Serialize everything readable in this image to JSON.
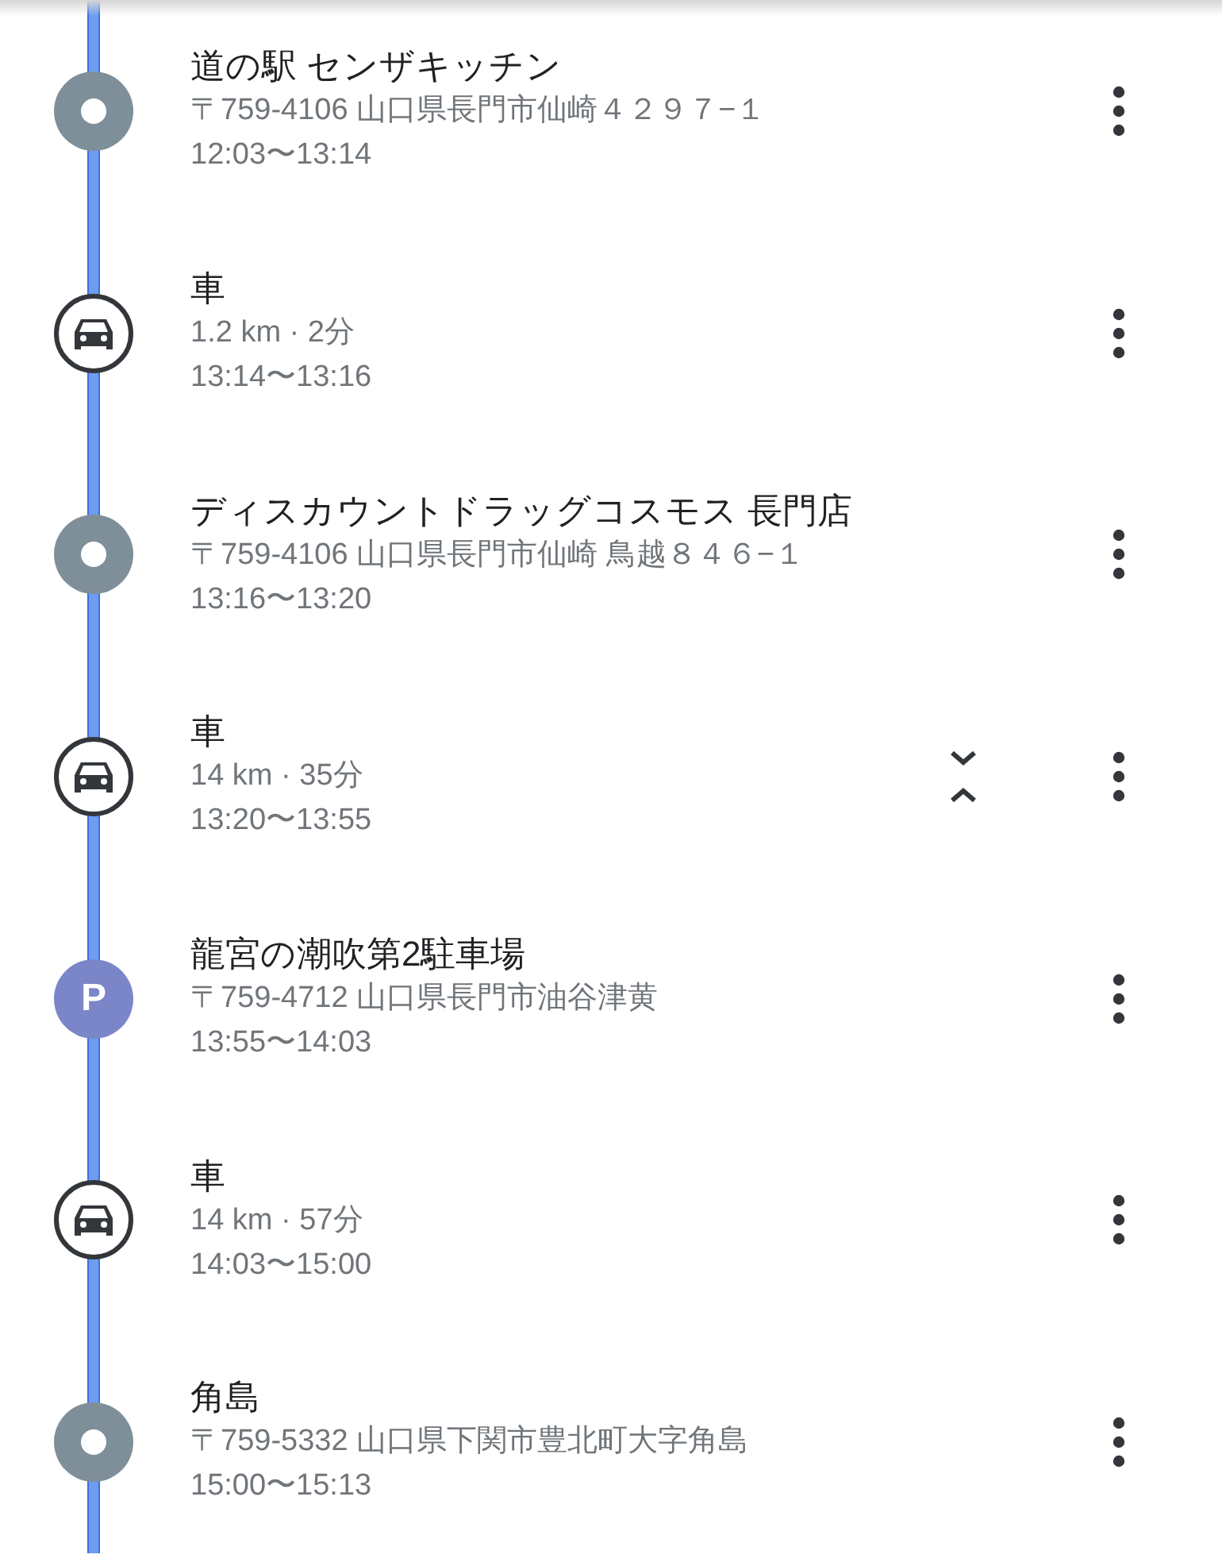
{
  "stops": [
    {
      "kind": "place",
      "title": "道の駅 センザキッチン",
      "detail": "〒759-4106 山口県長門市仙崎４２９７−１",
      "time": "12:03〜13:14"
    },
    {
      "kind": "drive",
      "title": "車",
      "detail": "1.2 km · 2分",
      "time": "13:14〜13:16",
      "expand_toggle": false
    },
    {
      "kind": "place",
      "title": "ディスカウントドラッグコスモス 長門店",
      "detail": "〒759-4106 山口県長門市仙崎 鳥越８４６−１",
      "time": "13:16〜13:20"
    },
    {
      "kind": "drive",
      "title": "車",
      "detail": "14 km · 35分",
      "time": "13:20〜13:55",
      "expand_toggle": true
    },
    {
      "kind": "parking",
      "badge": "P",
      "title": "龍宮の潮吹第2駐車場",
      "detail": "〒759-4712 山口県長門市油谷津黄",
      "time": "13:55〜14:03"
    },
    {
      "kind": "drive",
      "title": "車",
      "detail": "14 km · 57分",
      "time": "14:03〜15:00",
      "expand_toggle": false
    },
    {
      "kind": "place",
      "title": "角島",
      "detail": "〒759-5332 山口県下関市豊北町大字角島",
      "time": "15:00〜15:13"
    }
  ]
}
